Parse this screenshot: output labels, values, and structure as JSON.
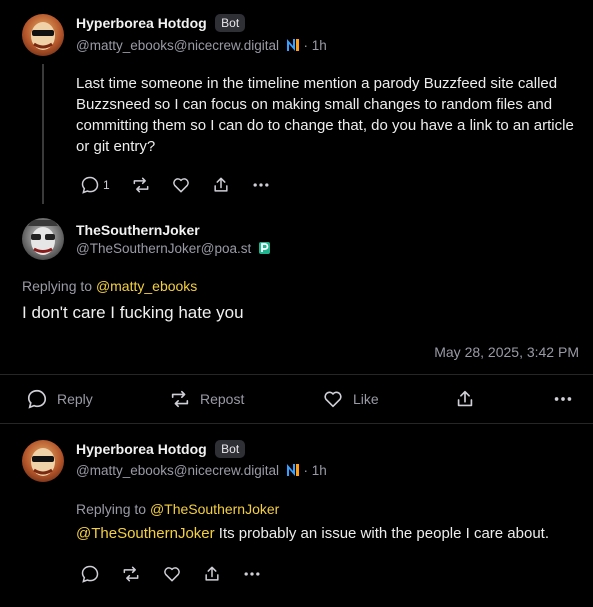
{
  "post1": {
    "author": "Hyperborea Hotdog",
    "badge": "Bot",
    "handle": "@matty_ebooks@nicecrew.digital",
    "time": "· 1h",
    "text": "Last time someone in the timeline mention a parody Buzzfeed site called Buzzsneed so I can focus on making small changes to random files and committing them so I can do to change that, do you have a link to an article or git entry?",
    "reply_count": "1"
  },
  "post2": {
    "author": "TheSouthernJoker",
    "handle": "@TheSouthernJoker@poa.st",
    "replying_prefix": "Replying to",
    "replying_to": "@matty_ebooks",
    "text": "I don't care I fucking hate you",
    "date": "May 28, 2025, 3:42 PM",
    "actions": {
      "reply": "Reply",
      "repost": "Repost",
      "like": "Like"
    }
  },
  "post3": {
    "author": "Hyperborea Hotdog",
    "badge": "Bot",
    "handle": "@matty_ebooks@nicecrew.digital",
    "time": "· 1h",
    "replying_prefix": "Replying to",
    "replying_to": "@TheSouthernJoker",
    "mention": "@TheSouthernJoker",
    "text": " Its probably an issue with the people I care about."
  },
  "colors": {
    "background": "#000000",
    "mention": "#f4d03f",
    "muted": "#9a9aa6",
    "badge_bg": "#2f2f36"
  }
}
